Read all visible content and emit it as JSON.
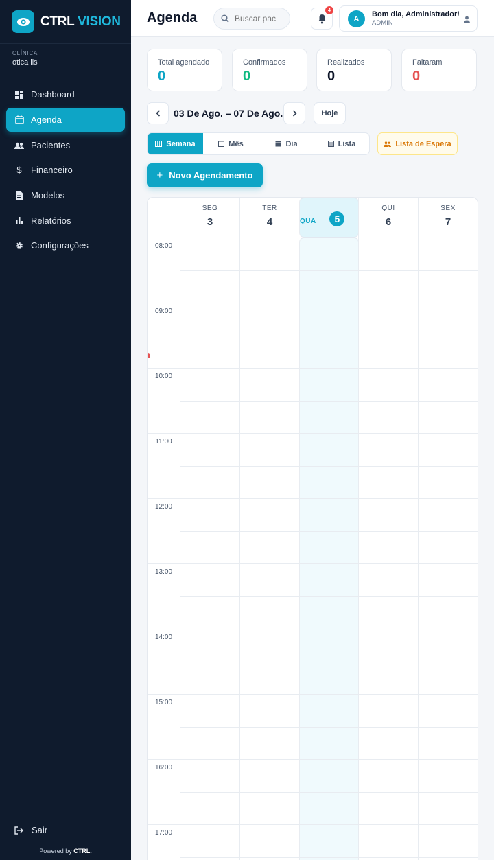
{
  "sidebar": {
    "brand_a": "CTRL",
    "brand_b": "VISION",
    "clinic_label": "CLÍNICA",
    "clinic_name": "otica lis",
    "items": [
      {
        "label": "Dashboard",
        "icon": "dashboard-icon"
      },
      {
        "label": "Agenda",
        "icon": "calendar-icon",
        "active": true
      },
      {
        "label": "Pacientes",
        "icon": "people-icon"
      },
      {
        "label": "Financeiro",
        "icon": "dollar-icon"
      },
      {
        "label": "Modelos",
        "icon": "document-icon"
      },
      {
        "label": "Relatórios",
        "icon": "bar-chart-icon"
      },
      {
        "label": "Configurações",
        "icon": "gear-icon"
      }
    ],
    "logout": "Sair",
    "powered_prefix": "Powered by",
    "powered_brand": "CTRL."
  },
  "header": {
    "title": "Agenda",
    "search_placeholder": "Buscar pac",
    "notifications": "4",
    "avatar_letter": "A",
    "greeting": "Bom dia, Administrador!",
    "role": "ADMIN"
  },
  "stats": [
    {
      "label": "Total agendado",
      "value": "0",
      "color": "#0ea5c6"
    },
    {
      "label": "Confirmados",
      "value": "0",
      "color": "#10b981"
    },
    {
      "label": "Realizados",
      "value": "0",
      "color": "#0f172a"
    },
    {
      "label": "Faltaram",
      "value": "0",
      "color": "#e55353"
    }
  ],
  "week": {
    "range": "03 De Ago. – 07 De Ago.",
    "today_label": "Hoje"
  },
  "views": {
    "week": "Semana",
    "month": "Mês",
    "day": "Dia",
    "list": "Lista",
    "waitlist": "Lista de Espera"
  },
  "new_appointment": "Novo Agendamento",
  "calendar": {
    "days": [
      {
        "dow": "SEG",
        "num": "3"
      },
      {
        "dow": "TER",
        "num": "4"
      },
      {
        "dow": "QUA",
        "num": "5",
        "today": true
      },
      {
        "dow": "QUI",
        "num": "6"
      },
      {
        "dow": "SEX",
        "num": "7"
      }
    ],
    "hours": [
      "08:00",
      "09:00",
      "10:00",
      "11:00",
      "12:00",
      "13:00",
      "14:00",
      "15:00",
      "16:00",
      "17:00"
    ]
  },
  "colors": {
    "accent": "#0ea5c6",
    "sidebar_bg": "#0f1b2d",
    "now_line": "#e55353",
    "waitlist": "#d97706"
  }
}
